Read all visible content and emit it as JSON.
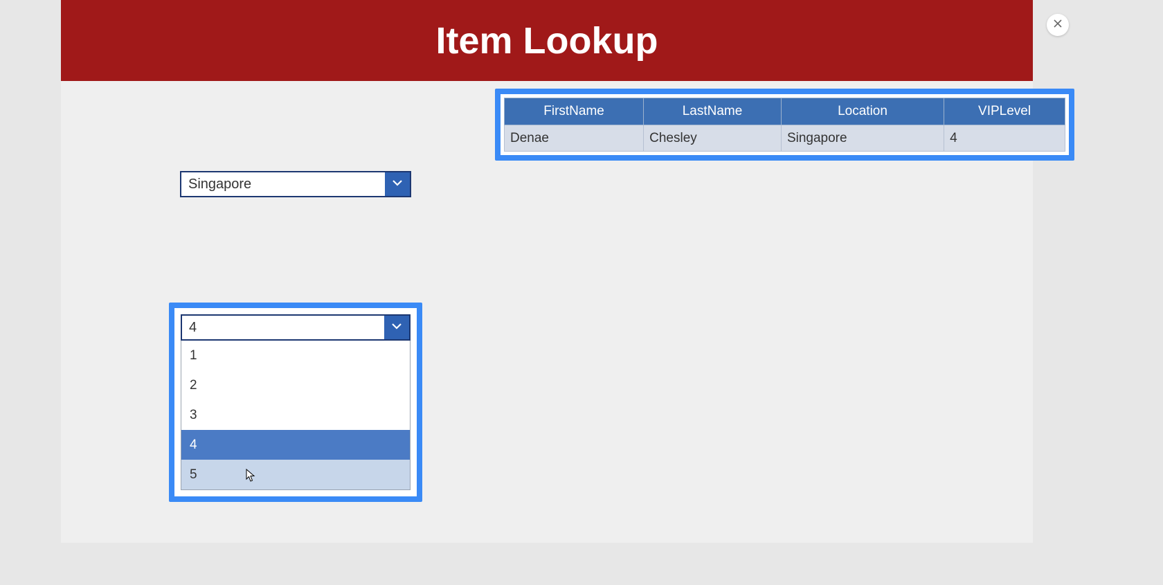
{
  "header": {
    "title": "Item Lookup"
  },
  "close_label": "Close",
  "location_dropdown": {
    "selected": "Singapore"
  },
  "vip_dropdown": {
    "selected": "4",
    "options": [
      "1",
      "2",
      "3",
      "4",
      "5"
    ],
    "selected_index": 3,
    "hover_index": 4
  },
  "table": {
    "headers": [
      "FirstName",
      "LastName",
      "Location",
      "VIPLevel"
    ],
    "rows": [
      {
        "FirstName": "Denae",
        "LastName": "Chesley",
        "Location": "Singapore",
        "VIPLevel": "4"
      }
    ]
  },
  "colors": {
    "header_bg": "#a01919",
    "highlight_border": "#3a8af6",
    "table_header_bg": "#3c6fb3",
    "dropdown_border": "#1c3771",
    "dropdown_chev_bg": "#2f62b3"
  }
}
